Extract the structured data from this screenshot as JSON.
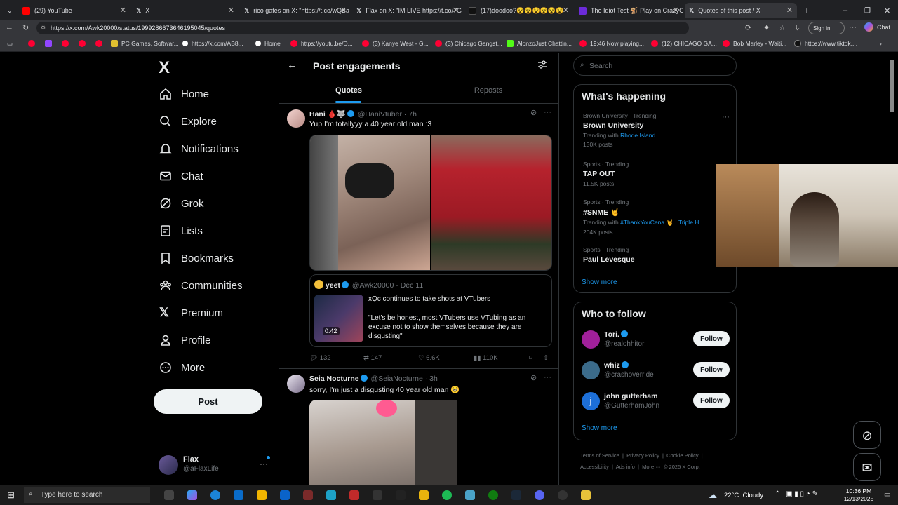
{
  "tabs": [
    {
      "label": "(29) YouTube",
      "color": "#ff0000"
    },
    {
      "label": "X",
      "color": "#ffffff"
    },
    {
      "label": "rico gates on X: \"https://t.co/wQBa",
      "color": "#ffffff"
    },
    {
      "label": "Flax on X: \"IM LIVE https://t.co/7G",
      "color": "#ffffff"
    },
    {
      "label": "(17)doodoo?😵😵😵😵😵😵",
      "color": "#ffffff"
    },
    {
      "label": "The Idiot Test 🐒 Play on CrazyGa",
      "color": "#6c2bd9"
    },
    {
      "label": "Quotes of this post / X",
      "color": "#ffffff"
    }
  ],
  "address": {
    "url": "https://x.com/Awk20000/status/1999286673646195045/quotes",
    "signin": "Sign in",
    "chat": "Chat"
  },
  "bookmarks": [
    "PC Games, Softwar...",
    "https://x.com/AB8...",
    "Home",
    "https://youtu.be/D...",
    "(3) Kanye West - G...",
    "(3) Chicago Gangst...",
    "AlonzoJust Chattin...",
    "19:46 Now playing...",
    "(12) CHICAGO GA...",
    "Bob Marley - Waiti...",
    "https://www.tiktok...."
  ],
  "nav": {
    "logo": "X",
    "items": [
      "Home",
      "Explore",
      "Notifications",
      "Chat",
      "Grok",
      "Lists",
      "Bookmarks",
      "Communities",
      "Premium",
      "Profile",
      "More"
    ],
    "post": "Post",
    "user": {
      "name": "Flax",
      "handle": "@aFlaxLife"
    }
  },
  "center": {
    "title": "Post engagements",
    "tabs": [
      "Quotes",
      "Reposts"
    ],
    "post1": {
      "name": "Hani 🩸🐺",
      "handle": "@HaniVtuber · 7h",
      "text": "Yup I'm totallyyy a 40 year old man :3",
      "quote": {
        "name": "yeet",
        "handle": "@Awk20000 · Dec 11",
        "text1": "xQc continues to take shots at VTubers",
        "text2": "\"Let's be honest, most VTubers use VTubing as an excuse not to show themselves because they are disgusting\"",
        "duration": "0:42"
      },
      "stats": {
        "replies": "132",
        "reposts": "147",
        "likes": "6.6K",
        "views": "110K"
      }
    },
    "post2": {
      "name": "Seia Nocturne",
      "handle": "@SeiaNocturne · 3h",
      "text": "sorry, I'm just a disgusting 40 year old man 🥺"
    }
  },
  "right": {
    "search_placeholder": "Search",
    "happening_title": "What's happening",
    "trends": [
      {
        "meta": "Brown University · Trending",
        "name": "Brown University",
        "with": "Trending with",
        "tag": "Rhode Island",
        "count": "130K posts"
      },
      {
        "meta": "Sports · Trending",
        "name": "TAP OUT",
        "count": "11.5K posts"
      },
      {
        "meta": "Sports · Trending",
        "name": "#SNME 🤘",
        "with": "Trending with",
        "tag": "#ThankYouCena 🤘 , Triple H",
        "count": "204K posts"
      },
      {
        "meta": "Sports · Trending",
        "name": "Paul Levesque"
      }
    ],
    "show_more": "Show more",
    "follow_title": "Who to follow",
    "follows": [
      {
        "name": "Tori.",
        "handle": "@realohhitori",
        "btn": "Follow",
        "color": "#a0209a"
      },
      {
        "name": "whiz",
        "handle": "@crashoverride",
        "btn": "Follow",
        "color": "#3b6b8a"
      },
      {
        "name": "john gutterham",
        "handle": "@GutterhamJohn",
        "btn": "Follow",
        "color": "#1d6fd8",
        "initial": "j"
      }
    ],
    "footer": [
      "Terms of Service",
      "Privacy Policy",
      "Cookie Policy",
      "Accessibility",
      "Ads info",
      "More ···",
      "© 2025 X Corp."
    ]
  },
  "taskbar": {
    "search": "Type here to search",
    "weather": "22°C  Cloudy",
    "time": "10:36 PM",
    "date": "12/13/2025"
  }
}
